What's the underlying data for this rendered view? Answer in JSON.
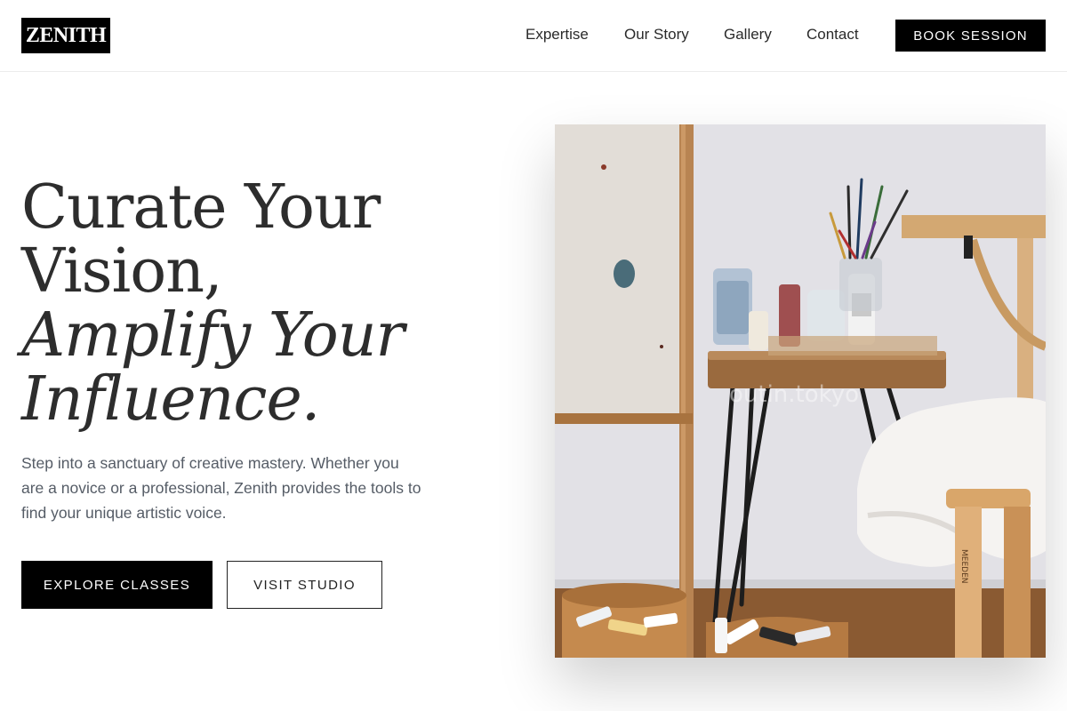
{
  "header": {
    "logo_text": "ZENITH",
    "nav": [
      {
        "label": "Expertise"
      },
      {
        "label": "Our Story"
      },
      {
        "label": "Gallery"
      },
      {
        "label": "Contact"
      }
    ],
    "cta_label": "BOOK SESSION"
  },
  "hero": {
    "title_line1": "Curate Your",
    "title_line2": "Vision,",
    "title_line3": "Amplify Your",
    "title_line4": "Influence.",
    "description": "Step into a sanctuary of creative mastery. Whether you are a novice or a professional, Zenith provides the tools to find your unique artistic voice.",
    "primary_button": "EXPLORE CLASSES",
    "secondary_button": "VISIT STUDIO",
    "image": {
      "subject": "art-studio-photo",
      "watermark": "outin.tokyo",
      "stool_text": "MEEDEN"
    }
  },
  "colors": {
    "primary": "#000000",
    "text_dark": "#2d2d2d",
    "text_muted": "#555c66",
    "background": "#ffffff"
  }
}
